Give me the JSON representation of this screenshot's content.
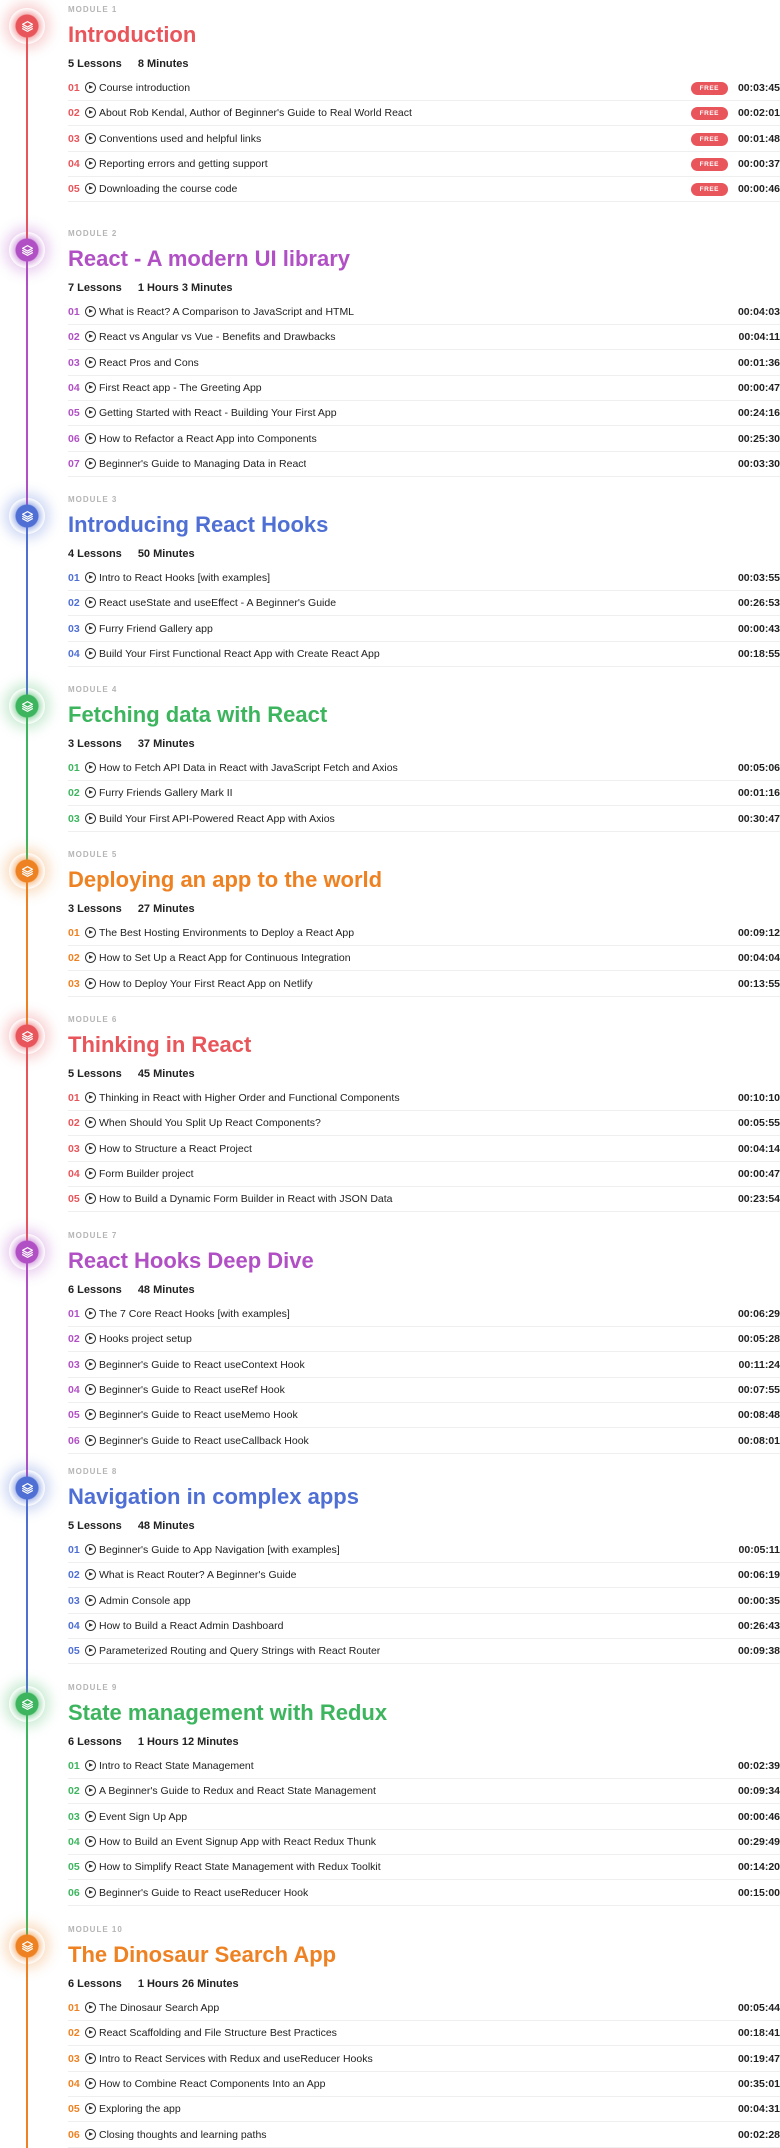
{
  "modules": [
    {
      "label": "MODULE 1",
      "title": "Introduction",
      "lessons_count": "5 Lessons",
      "duration": "8 Minutes",
      "color": "#e8555a",
      "lessons": [
        {
          "num": "01",
          "title": "Course introduction",
          "free": "FREE",
          "time": "00:03:45"
        },
        {
          "num": "02",
          "title": "About Rob Kendal, Author of Beginner's Guide to Real World React",
          "free": "FREE",
          "time": "00:02:01"
        },
        {
          "num": "03",
          "title": "Conventions used and helpful links",
          "free": "FREE",
          "time": "00:01:48"
        },
        {
          "num": "04",
          "title": "Reporting errors and getting support",
          "free": "FREE",
          "time": "00:00:37"
        },
        {
          "num": "05",
          "title": "Downloading the course code",
          "free": "FREE",
          "time": "00:00:46"
        }
      ]
    },
    {
      "label": "MODULE 2",
      "title": "React - A modern UI library",
      "lessons_count": "7 Lessons",
      "duration": "1 Hours 3 Minutes",
      "color": "#b150c5",
      "lessons": [
        {
          "num": "01",
          "title": "What is React? A Comparison to JavaScript and HTML",
          "time": "00:04:03"
        },
        {
          "num": "02",
          "title": "React vs Angular vs Vue - Benefits and Drawbacks",
          "time": "00:04:11"
        },
        {
          "num": "03",
          "title": "React Pros and Cons",
          "time": "00:01:36"
        },
        {
          "num": "04",
          "title": "First React app - The Greeting App",
          "time": "00:00:47"
        },
        {
          "num": "05",
          "title": "Getting Started with React - Building Your First App",
          "time": "00:24:16"
        },
        {
          "num": "06",
          "title": "How to Refactor a React App into Components",
          "time": "00:25:30"
        },
        {
          "num": "07",
          "title": "Beginner's Guide to Managing Data in React",
          "time": "00:03:30"
        }
      ]
    },
    {
      "label": "MODULE 3",
      "title": "Introducing React Hooks",
      "lessons_count": "4 Lessons",
      "duration": "50 Minutes",
      "color": "#4f6fd4",
      "lessons": [
        {
          "num": "01",
          "title": "Intro to React Hooks [with examples]",
          "time": "00:03:55"
        },
        {
          "num": "02",
          "title": "React useState and useEffect - A Beginner's Guide",
          "time": "00:26:53"
        },
        {
          "num": "03",
          "title": "Furry Friend Gallery app",
          "time": "00:00:43"
        },
        {
          "num": "04",
          "title": "Build Your First Functional React App with Create React App",
          "time": "00:18:55"
        }
      ]
    },
    {
      "label": "MODULE 4",
      "title": "Fetching data with React",
      "lessons_count": "3 Lessons",
      "duration": "37 Minutes",
      "color": "#3db55e",
      "lessons": [
        {
          "num": "01",
          "title": "How to Fetch API Data in React with JavaScript Fetch and Axios",
          "time": "00:05:06"
        },
        {
          "num": "02",
          "title": "Furry Friends Gallery Mark II",
          "time": "00:01:16"
        },
        {
          "num": "03",
          "title": "Build Your First API-Powered React App with Axios",
          "time": "00:30:47"
        }
      ]
    },
    {
      "label": "MODULE 5",
      "title": "Deploying an app to the world",
      "lessons_count": "3 Lessons",
      "duration": "27 Minutes",
      "color": "#ee8222",
      "lessons": [
        {
          "num": "01",
          "title": "The Best Hosting Environments to Deploy a React App",
          "time": "00:09:12"
        },
        {
          "num": "02",
          "title": "How to Set Up a React App for Continuous Integration",
          "time": "00:04:04"
        },
        {
          "num": "03",
          "title": "How to Deploy Your First React App on Netlify",
          "time": "00:13:55"
        }
      ]
    },
    {
      "label": "MODULE 6",
      "title": "Thinking in React",
      "lessons_count": "5 Lessons",
      "duration": "45 Minutes",
      "color": "#e8555a",
      "lessons": [
        {
          "num": "01",
          "title": "Thinking in React with Higher Order and Functional Components",
          "time": "00:10:10"
        },
        {
          "num": "02",
          "title": "When Should You Split Up React Components?",
          "time": "00:05:55"
        },
        {
          "num": "03",
          "title": "How to Structure a React Project",
          "time": "00:04:14"
        },
        {
          "num": "04",
          "title": "Form Builder project",
          "time": "00:00:47"
        },
        {
          "num": "05",
          "title": "How to Build a Dynamic Form Builder in React with JSON Data",
          "time": "00:23:54"
        }
      ]
    },
    {
      "label": "MODULE 7",
      "title": "React Hooks Deep Dive",
      "lessons_count": "6 Lessons",
      "duration": "48 Minutes",
      "color": "#b150c5",
      "lessons": [
        {
          "num": "01",
          "title": "The 7 Core React Hooks [with examples]",
          "time": "00:06:29"
        },
        {
          "num": "02",
          "title": "Hooks project setup",
          "time": "00:05:28"
        },
        {
          "num": "03",
          "title": "Beginner's Guide to React useContext Hook",
          "time": "00:11:24"
        },
        {
          "num": "04",
          "title": "Beginner's Guide to React useRef Hook",
          "time": "00:07:55"
        },
        {
          "num": "05",
          "title": "Beginner's Guide to React useMemo Hook",
          "time": "00:08:48"
        },
        {
          "num": "06",
          "title": "Beginner's Guide to React useCallback Hook",
          "time": "00:08:01"
        }
      ]
    },
    {
      "label": "MODULE 8",
      "title": "Navigation in complex apps",
      "lessons_count": "5 Lessons",
      "duration": "48 Minutes",
      "color": "#4f6fd4",
      "lessons": [
        {
          "num": "01",
          "title": "Beginner's Guide to App Navigation [with examples]",
          "time": "00:05:11"
        },
        {
          "num": "02",
          "title": "What is React Router? A Beginner's Guide",
          "time": "00:06:19"
        },
        {
          "num": "03",
          "title": "Admin Console app",
          "time": "00:00:35"
        },
        {
          "num": "04",
          "title": "How to Build a React Admin Dashboard",
          "time": "00:26:43"
        },
        {
          "num": "05",
          "title": "Parameterized Routing and Query Strings with React Router",
          "time": "00:09:38"
        }
      ]
    },
    {
      "label": "MODULE 9",
      "title": "State management with Redux",
      "lessons_count": "6 Lessons",
      "duration": "1 Hours 12 Minutes",
      "color": "#3db55e",
      "lessons": [
        {
          "num": "01",
          "title": "Intro to React State Management",
          "time": "00:02:39"
        },
        {
          "num": "02",
          "title": "A Beginner's Guide to Redux and React State Management",
          "time": "00:09:34"
        },
        {
          "num": "03",
          "title": "Event Sign Up App",
          "time": "00:00:46"
        },
        {
          "num": "04",
          "title": "How to Build an Event Signup App with React Redux Thunk",
          "time": "00:29:49"
        },
        {
          "num": "05",
          "title": "How to Simplify React State Management with Redux Toolkit",
          "time": "00:14:20"
        },
        {
          "num": "06",
          "title": "Beginner's Guide to React useReducer Hook",
          "time": "00:15:00"
        }
      ]
    },
    {
      "label": "MODULE 10",
      "title": "The Dinosaur Search App",
      "lessons_count": "6 Lessons",
      "duration": "1 Hours 26 Minutes",
      "color": "#ee8222",
      "lessons": [
        {
          "num": "01",
          "title": "The Dinosaur Search App",
          "time": "00:05:44"
        },
        {
          "num": "02",
          "title": "React Scaffolding and File Structure Best Practices",
          "time": "00:18:41"
        },
        {
          "num": "03",
          "title": "Intro to React Services with Redux and useReducer Hooks",
          "time": "00:19:47"
        },
        {
          "num": "04",
          "title": "How to Combine React Components Into an App",
          "time": "00:35:01"
        },
        {
          "num": "05",
          "title": "Exploring the app",
          "time": "00:04:31"
        },
        {
          "num": "06",
          "title": "Closing thoughts and learning paths",
          "time": "00:02:28"
        }
      ]
    }
  ]
}
